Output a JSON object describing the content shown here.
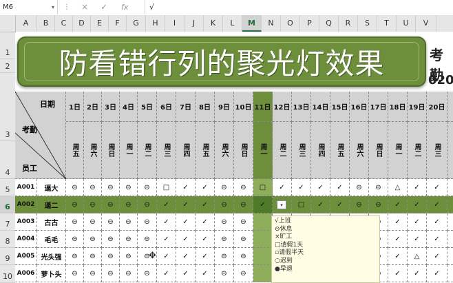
{
  "formula_bar": {
    "name_box": "M6",
    "name_box_dropdown": "▾",
    "dots": "⋮",
    "cancel_icon": "×",
    "enter_icon": "✓",
    "fx_label": "fx",
    "value": "√"
  },
  "columns": [
    "A",
    "B",
    "C",
    "D",
    "E",
    "F",
    "G",
    "H",
    "I",
    "J",
    "K",
    "L",
    "M",
    "N",
    "O",
    "P",
    "Q",
    "R",
    "S",
    "T",
    "U",
    "V"
  ],
  "selected_column": "M",
  "rows": [
    "1",
    "2",
    "3",
    "4",
    "5",
    "6",
    "7",
    "8",
    "9",
    "10"
  ],
  "selected_row": "6",
  "banner": {
    "text": "防看错行列的聚光灯效果"
  },
  "title_right": "考勤",
  "year_right": "020",
  "header": {
    "date_label": "日期",
    "attendance_label": "考勤",
    "employee_label": "员工",
    "days": [
      "1日",
      "2日",
      "3日",
      "4日",
      "5日",
      "6日",
      "7日",
      "8日",
      "9日",
      "10日",
      "11日",
      "12日",
      "13日",
      "14日",
      "15日",
      "16日",
      "17日",
      "18日",
      "19日",
      "20日",
      "2"
    ],
    "weekdays": [
      "周五",
      "周六",
      "周日",
      "周一",
      "周二",
      "周三",
      "周四",
      "周五",
      "周六",
      "周日",
      "周一",
      "周二",
      "周三",
      "周四",
      "周五",
      "周六",
      "周日",
      "周一",
      "周二",
      "周三",
      "周"
    ]
  },
  "employees": [
    {
      "id": "A001",
      "name": "逼大",
      "marks": [
        "⊖",
        "⊖",
        "⊖",
        "⊖",
        "⊖",
        "□",
        "✓",
        "✓",
        "⊖",
        "⊖",
        "□",
        "✓",
        "✓",
        "✓",
        "✓",
        "⊖",
        "⊖",
        "△",
        "✓",
        "✓",
        "✓"
      ]
    },
    {
      "id": "A002",
      "name": "逼二",
      "marks": [
        "⊖",
        "⊖",
        "⊖",
        "⊖",
        "⊖",
        "✓",
        "✓",
        "✓",
        "⊖",
        "⊖",
        "✓",
        "",
        "□",
        "✓",
        "✓",
        "⊖",
        "⊖",
        "✓",
        "✓",
        "✓",
        "✓"
      ]
    },
    {
      "id": "A003",
      "name": "古古",
      "marks": [
        "⊖",
        "⊖",
        "⊖",
        "⊖",
        "⊖",
        "✓",
        "✓",
        "✓",
        "⊖",
        "⊖",
        "",
        "",
        "",
        "",
        "",
        "",
        "⊖",
        "✓",
        "✓",
        "✓",
        "✓"
      ]
    },
    {
      "id": "A004",
      "name": "毛毛",
      "marks": [
        "⊖",
        "⊖",
        "⊖",
        "⊖",
        "⊖",
        "✓",
        "✓",
        "✓",
        "⊖",
        "⊖",
        "",
        "",
        "",
        "",
        "",
        "",
        "⊖",
        "✓",
        "✓",
        "✓",
        "✓"
      ]
    },
    {
      "id": "A005",
      "name": "光头强",
      "marks": [
        "⊖",
        "⊖",
        "⊖",
        "⊖",
        "⊖",
        "✓",
        "✓",
        "✓",
        "⊖",
        "⊖",
        "",
        "",
        "",
        "",
        "",
        "",
        "⊖",
        "✓",
        "△",
        "✓",
        "✓"
      ]
    },
    {
      "id": "A006",
      "name": "萝卜头",
      "marks": [
        "⊖",
        "⊖",
        "⊖",
        "⊖",
        "⊖",
        "✓",
        "✓",
        "✓",
        "⊖",
        "⊖",
        "",
        "",
        "",
        "",
        "",
        "",
        "⊖",
        "✓",
        "✓",
        "✓",
        "✓"
      ]
    }
  ],
  "dropdown": {
    "button": "▾",
    "options": [
      "√上班",
      "⊖休息",
      "×旷工",
      "□请假1天",
      "▫请假半天",
      "○迟到",
      "●早退"
    ]
  },
  "cursor": "✥",
  "colors": {
    "accent": "#6d8f3c",
    "excel_green": "#217346"
  }
}
